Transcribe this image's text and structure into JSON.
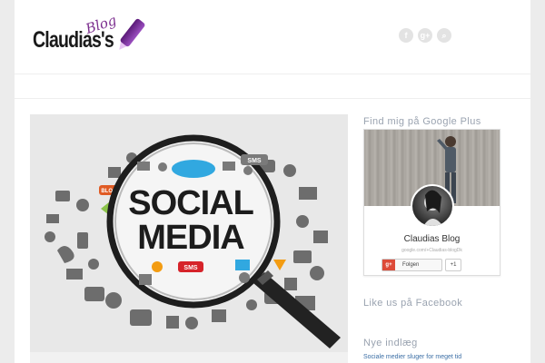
{
  "header": {
    "logo_main": "Claudias's",
    "logo_script": "Blog",
    "social_icons": [
      {
        "icon": "facebook-icon",
        "glyph": "f"
      },
      {
        "icon": "googleplus-icon",
        "glyph": "g+"
      },
      {
        "icon": "search-icon",
        "glyph": "⌕"
      }
    ]
  },
  "post": {
    "image_words": [
      "SOCIAL",
      "MEDIA"
    ],
    "image_tags": [
      "BLOG",
      "SMS",
      "BLOG",
      "SMS",
      "BLOG"
    ]
  },
  "sidebar": {
    "google_plus_title": "Find mig på Google Plus",
    "gp_name": "Claudias Blog",
    "gp_url": "google.com/+Claudias-blogDk",
    "gp_follow": "Folgen",
    "gp_count": "+1",
    "facebook_title": "Like us på Facebook",
    "recent_title": "Nye indlæg",
    "recent_posts": [
      "Sociale medier sluger for meget tid"
    ]
  },
  "colors": {
    "accent": "#7b2d8e",
    "sidebar_heading": "#9aa3b0",
    "link": "#3b6ea5"
  }
}
